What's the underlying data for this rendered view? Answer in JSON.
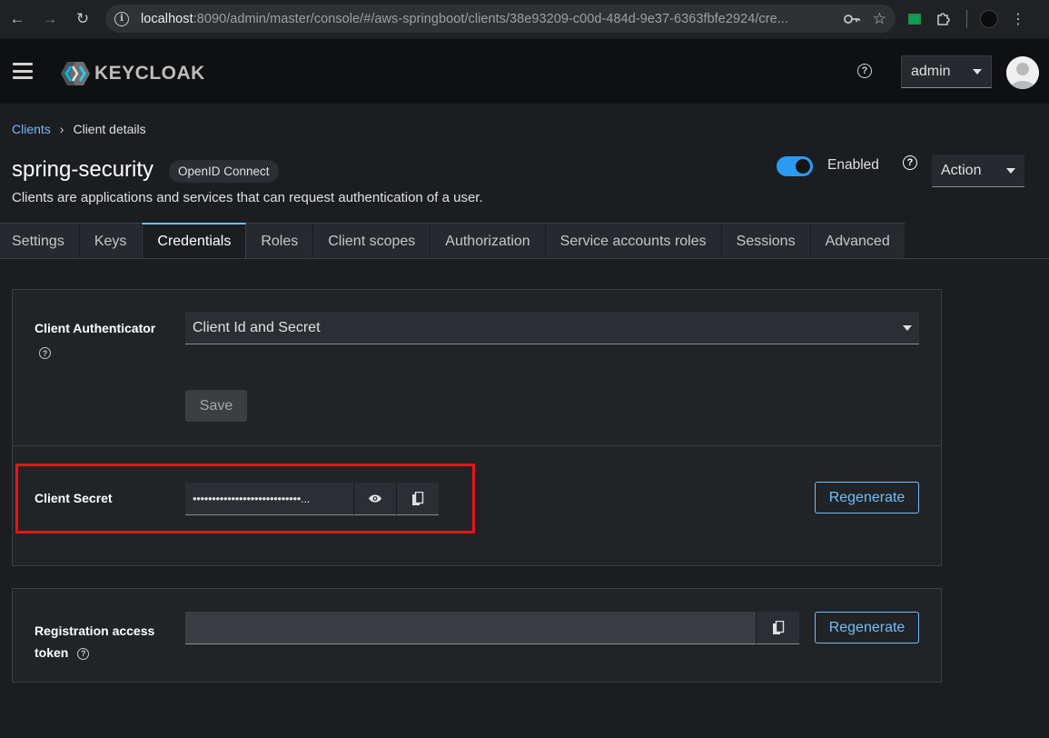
{
  "browser": {
    "url_host": "localhost",
    "url_rest": ":8090/admin/master/console/#/aws-springboot/clients/38e93209-c00d-484d-9e37-6363fbfe2924/cre..."
  },
  "header": {
    "logo_text": "KEYCLOAK",
    "user": "admin"
  },
  "breadcrumb": {
    "parent": "Clients",
    "current": "Client details"
  },
  "client": {
    "name": "spring-security",
    "protocol": "OpenID Connect",
    "description": "Clients are applications and services that can request authentication of a user.",
    "enabled_label": "Enabled",
    "action_label": "Action"
  },
  "tabs": [
    {
      "label": "Settings"
    },
    {
      "label": "Keys"
    },
    {
      "label": "Credentials"
    },
    {
      "label": "Roles"
    },
    {
      "label": "Client scopes"
    },
    {
      "label": "Authorization"
    },
    {
      "label": "Service accounts roles"
    },
    {
      "label": "Sessions"
    },
    {
      "label": "Advanced"
    }
  ],
  "credentials": {
    "authenticator_label": "Client Authenticator",
    "authenticator_value": "Client Id and Secret",
    "save_label": "Save",
    "secret_label": "Client Secret",
    "secret_value": "••••••••••••••••••••••••••••...",
    "regenerate_label": "Regenerate",
    "token_label_line1": "Registration access",
    "token_label_line2": "token",
    "token_regenerate_label": "Regenerate"
  },
  "colors": {
    "accent": "#73bcf7",
    "toggle": "#2b9af3",
    "highlight": "#e8141a"
  }
}
